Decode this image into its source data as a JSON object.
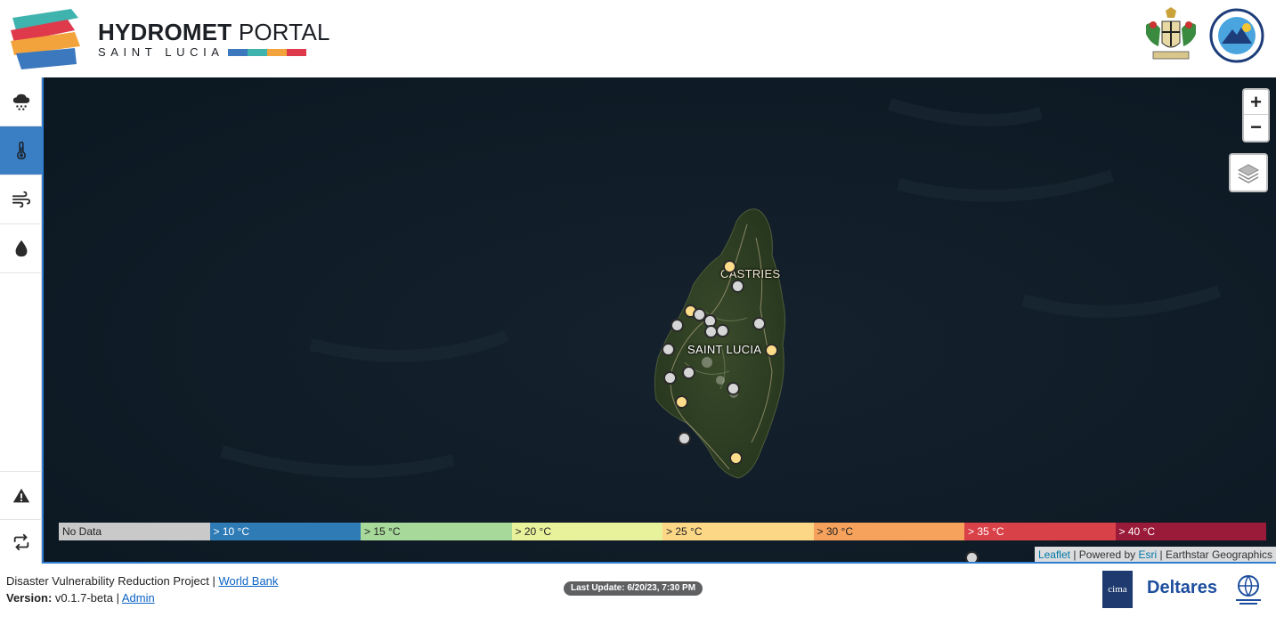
{
  "header": {
    "brand_bold": "HYDROMET",
    "brand_light": " PORTAL",
    "brand_subtitle": "SAINT LUCIA",
    "stripe_colors": [
      "#3b78bd",
      "#3fb4ae",
      "#f3a33b",
      "#de3a4c"
    ]
  },
  "sidebar": {
    "items": [
      {
        "name": "rain-cloud-icon",
        "active": false
      },
      {
        "name": "thermometer-icon",
        "active": true
      },
      {
        "name": "wind-icon",
        "active": false
      },
      {
        "name": "water-drop-icon",
        "active": false
      }
    ],
    "bottom_items": [
      {
        "name": "warning-icon"
      },
      {
        "name": "refresh-icon"
      }
    ]
  },
  "map": {
    "labels": {
      "city": "CASTRIES",
      "country": "SAINT LUCIA"
    },
    "zoom_in": "+",
    "zoom_out": "−",
    "stations": [
      {
        "type": "t25"
      },
      {
        "type": "nodata"
      },
      {
        "type": "t25"
      },
      {
        "type": "nodata"
      },
      {
        "type": "nodata"
      },
      {
        "type": "nodata"
      },
      {
        "type": "nodata"
      },
      {
        "type": "nodata"
      },
      {
        "type": "nodata"
      },
      {
        "type": "nodata"
      },
      {
        "type": "t25"
      },
      {
        "type": "nodata"
      },
      {
        "type": "nodata"
      },
      {
        "type": "nodata"
      },
      {
        "type": "t25"
      },
      {
        "type": "nodata"
      },
      {
        "type": "t25"
      },
      {
        "type": "nodata"
      }
    ]
  },
  "legend": [
    {
      "label": "No Data",
      "color": "#c9c9c9",
      "text": "#222222"
    },
    {
      "label": "> 10 °C",
      "color": "#2f7bb6",
      "text": "#ffffff"
    },
    {
      "label": "> 15 °C",
      "color": "#a6d99a",
      "text": "#222222"
    },
    {
      "label": "> 20 °C",
      "color": "#e8f29a",
      "text": "#222222"
    },
    {
      "label": "> 25 °C",
      "color": "#fcd886",
      "text": "#222222"
    },
    {
      "label": "> 30 °C",
      "color": "#f6a25c",
      "text": "#222222"
    },
    {
      "label": "> 35 °C",
      "color": "#d94149",
      "text": "#ffffff"
    },
    {
      "label": "> 40 °C",
      "color": "#9a1a39",
      "text": "#ffffff"
    }
  ],
  "attribution": {
    "leaflet": "Leaflet",
    "powered_by": " | Powered by ",
    "esri": "Esri",
    "rest": " | Earthstar Geographics"
  },
  "footer": {
    "project": "Disaster Vulnerability Reduction Project | ",
    "world_bank_link": "World Bank",
    "version_label": "Version:",
    "version_value": " v0.1.7-beta | ",
    "admin_link": "Admin",
    "last_update": "Last Update: 6/20/23, 7:30 PM",
    "partner_cima": "cima",
    "partner_deltares": "Deltares"
  }
}
